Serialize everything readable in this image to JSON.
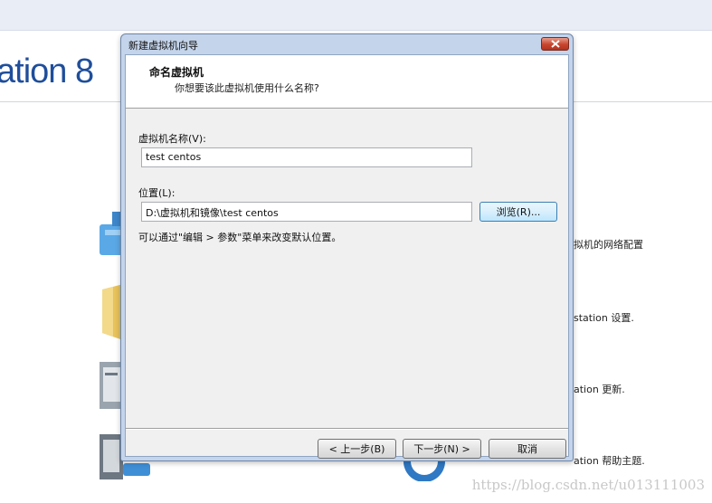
{
  "background": {
    "app_title": "ation 8",
    "items": [
      {
        "text": "拟机的网络配置"
      },
      {
        "text": "station 设置."
      },
      {
        "text": "ation 更新."
      },
      {
        "text": "ation 帮助主题."
      }
    ]
  },
  "dialog": {
    "window_title": "新建虚拟机向导",
    "header_title": "命名虚拟机",
    "header_subtitle": "你想要该此虚拟机使用什么名称?",
    "vm_name_label": "虚拟机名称(V):",
    "vm_name_value": "test centos",
    "location_label": "位置(L):",
    "location_value": "D:\\虚拟机和镜像\\test centos",
    "browse_label": "浏览(R)...",
    "hint_text": "可以通过\"编辑 > 参数\"菜单来改变默认位置。",
    "back_label": "< 上一步(B)",
    "next_label": "下一步(N) >",
    "cancel_label": "取消"
  },
  "watermark": "https://blog.csdn.net/u013111003"
}
